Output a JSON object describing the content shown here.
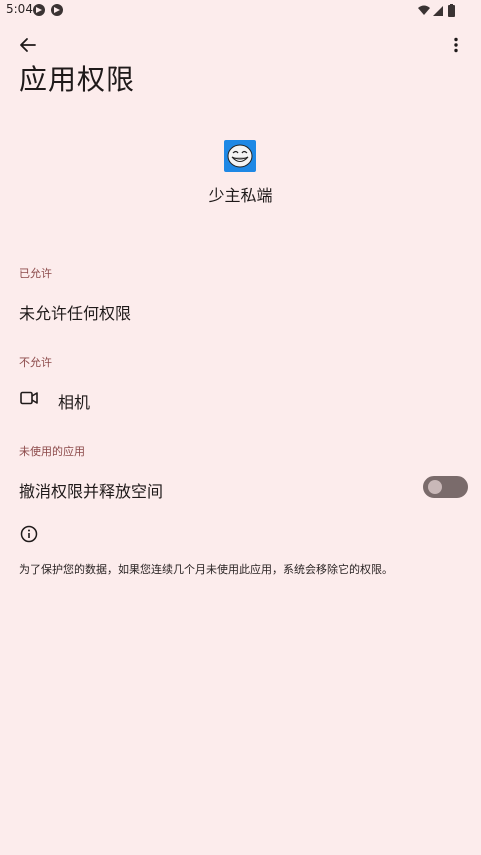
{
  "status_bar": {
    "time": "5:04",
    "icons": [
      "telegram-icon",
      "telegram-icon",
      "wifi-icon",
      "signal-icon",
      "battery-icon"
    ]
  },
  "toolbar": {
    "back_icon": "arrow-back-icon",
    "more_icon": "more-vert-icon"
  },
  "page": {
    "title": "应用权限"
  },
  "app": {
    "name": "少主私端",
    "icon": "troll-face-icon"
  },
  "sections": {
    "allowed": {
      "header": "已允许",
      "items": [
        {
          "label": "未允许任何权限"
        }
      ]
    },
    "denied": {
      "header": "不允许",
      "items": [
        {
          "label": "相机",
          "icon": "camera-icon"
        }
      ]
    },
    "unused": {
      "header": "未使用的应用",
      "toggle_label": "撤消权限并释放空间",
      "toggle_on": false
    }
  },
  "footer": {
    "info_icon": "info-icon",
    "text": "为了保护您的数据，如果您连续几个月未使用此应用，系统会移除它的权限。"
  },
  "colors": {
    "background": "#fcecec",
    "section_header": "#8c4a4a",
    "toggle_track": "#7a6b6b",
    "app_icon_bg": "#1e88e5"
  }
}
